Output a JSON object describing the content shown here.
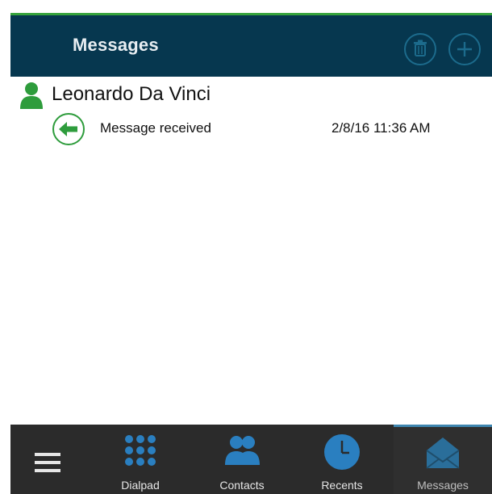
{
  "header": {
    "title": "Messages",
    "trash_icon": "trash-icon",
    "add_icon": "plus-icon",
    "accent": "#37a33c",
    "background": "#06374f"
  },
  "conversation": {
    "contact_name": "Leonardo Da Vinci",
    "contact_icon": "person-icon",
    "message_status": "Message received",
    "message_direction_icon": "incoming-arrow-icon",
    "timestamp": "2/8/16 11:36 AM"
  },
  "tabbar": {
    "menu_icon": "hamburger-menu-icon",
    "tabs": [
      {
        "label": "Dialpad",
        "icon": "dialpad-icon",
        "active": false
      },
      {
        "label": "Contacts",
        "icon": "contacts-icon",
        "active": false
      },
      {
        "label": "Recents",
        "icon": "clock-icon",
        "active": false
      },
      {
        "label": "Messages",
        "icon": "messages-icon",
        "active": true
      }
    ],
    "icon_color": "#2a7fc0",
    "background": "#2b2b2b"
  }
}
